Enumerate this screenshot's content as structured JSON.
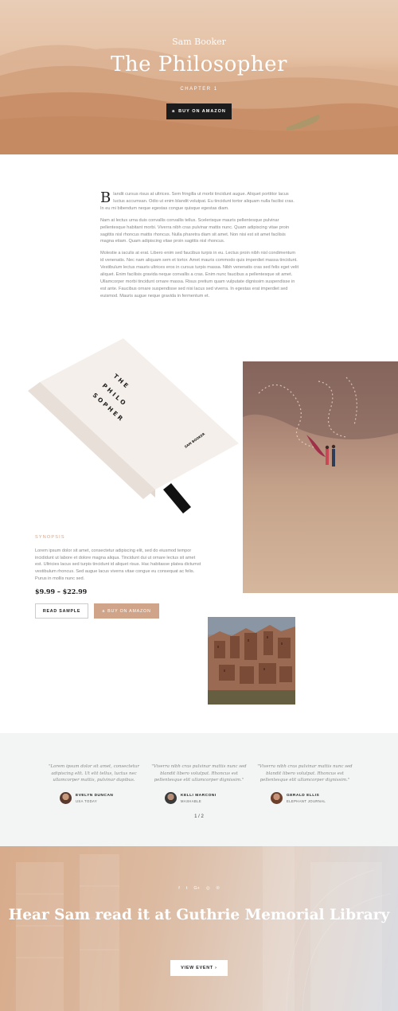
{
  "hero": {
    "author": "Sam Booker",
    "title": "The Philosopher",
    "chapter": "CHAPTER 1",
    "buy_label": "BUY ON AMAZON"
  },
  "intro": {
    "dropcap": "B",
    "p1": "landit cursus risus at ultrices. Sem fringilla ut morbi tincidunt augue. Aliquet porttitor lacus luctus accumsan. Odio ut enim blandit volutpat. Eu tincidunt tortor aliquam nulla facilisi cras. In eu mi bibendum neque egestas congue quisque egestas diam.",
    "p2": "Nam at lectus urna duis convallis convallis tellus. Scelerisque mauris pellentesque pulvinar pellentesque habitant morbi. Viverra nibh cras pulvinar mattis nunc. Quam adipiscing vitae proin sagittis nisl rhoncus mattis rhoncus. Nulla pharetra diam sit amet. Non nisi est sit amet facilisis magna etiam. Quam adipiscing vitae proin sagittis nisl rhoncus.",
    "p3": "Molestie a iaculis at erat. Libero enim sed faucibus turpis in eu. Lectus proin nibh nisl condimentum id venenatis. Nec nam aliquam sem et tortor. Amet mauris commodo quis imperdiet massa tincidunt. Vestibulum lectus mauris ultrices eros in cursus turpis massa. Nibh venenatis cras sed felis eget velit aliquet. Enim facilisis gravida neque convallis a cras. Enim nunc faucibus a pellentesque sit amet. Ullamcorper morbi tincidunt ornare massa. Risus pretium quam vulputate dignissim suspendisse in est ante. Faucibus ornare suspendisse sed nisi lacus sed viverra. In egestas erat imperdiet sed euismod. Mauris augue neque gravida in fermentum et."
  },
  "book": {
    "cover_lines": [
      "T H E",
      "P H I L O",
      "S O P H E R"
    ],
    "cover_author": "SAM BOOKER",
    "synopsis_label": "SYNOPSIS",
    "synopsis_text": "Lorem ipsum dolor sit amet, consectetur adipiscing elit, sed do eiusmod tempor incididunt ut labore et dolore magna aliqua. Tincidunt dui ut ornare lectus sit amet est. Ultricies lacus sed turpis tincidunt id aliquet risus. Hac habitasse platea dictumst vestibulum rhoncus. Sed augue lacus viverra vitae congue eu consequat ac felis. Purus in mollis nunc sed.",
    "price": "$9.99 – $22.99",
    "read_sample_label": "READ SAMPLE",
    "buy_label": "BUY ON AMAZON"
  },
  "testimonials": {
    "items": [
      {
        "quote": "\"Lorem ipsum dolor sit amet, consectetur adipiscing elit. Ut elit tellus, luctus nec ullamcorper mattis, pulvinar dapibus.",
        "name": "EVELYN DUNCAN",
        "publication": "USA TODAY"
      },
      {
        "quote": "\"Viverra nibh cras pulvinar mattis nunc sed blandit libero volutpat. Rhoncus est pellentesque elit ullamcorper dignissim.\"",
        "name": "KELLI MARCONI",
        "publication": "MASHABLE"
      },
      {
        "quote": "\"Viverra nibh cras pulvinar mattis nunc sed blandit libero volutpat. Rhoncus est pellentesque elit ullamcorper dignissim.\"",
        "name": "GERALD ELLIS",
        "publication": "ELEPHANT JOURNAL"
      }
    ],
    "pager": "1 / 2"
  },
  "footer": {
    "social_icons": [
      "f",
      "t",
      "G+",
      "◎",
      "℗"
    ],
    "title": "Hear Sam read it at Guthrie Memorial Library",
    "button_label": "VIEW EVENT ›"
  },
  "colors": {
    "accent": "#d0a489",
    "dark_button": "#1c1c1c",
    "testimonial_bg": "#f3f4f4"
  }
}
